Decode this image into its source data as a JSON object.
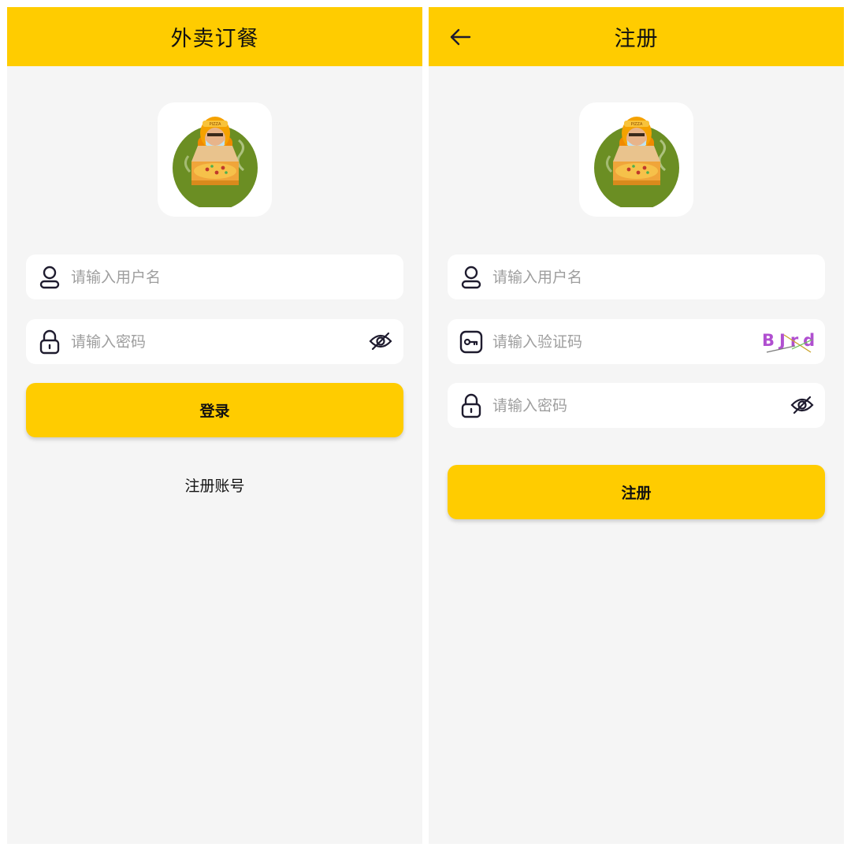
{
  "login": {
    "title": "外卖订餐",
    "username_placeholder": "请输入用户名",
    "password_placeholder": "请输入密码",
    "login_button": "登录",
    "register_link": "注册账号"
  },
  "register": {
    "title": "注册",
    "username_placeholder": "请输入用户名",
    "captcha_placeholder": "请输入验证码",
    "captcha_text": "BJrd",
    "password_placeholder": "请输入密码",
    "register_button": "注册"
  },
  "colors": {
    "accent": "#ffcc00",
    "background": "#f5f5f5",
    "field": "#ffffff",
    "icon": "#1e1b2e",
    "placeholder": "#9e9e9e"
  },
  "icons": {
    "user": "user-icon",
    "lock": "lock-icon",
    "eye_off": "eye-off-icon",
    "key": "key-icon",
    "back": "arrow-left-icon",
    "logo": "pizza-delivery-logo"
  }
}
